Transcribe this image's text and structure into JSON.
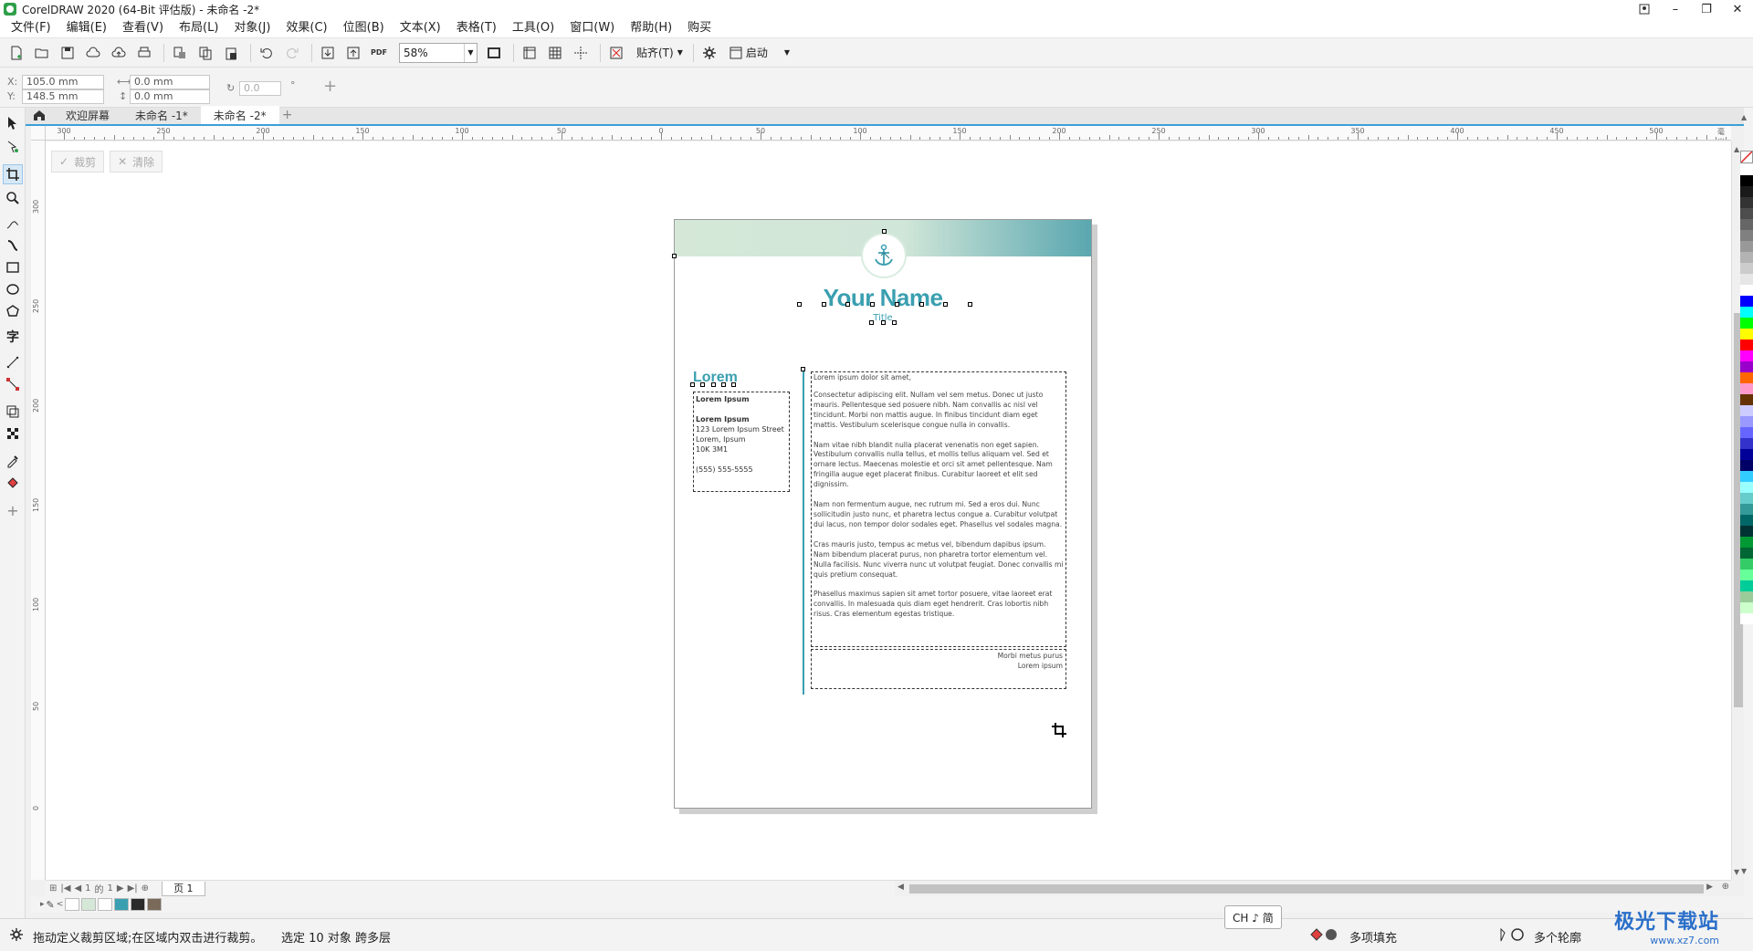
{
  "window": {
    "title": "CorelDRAW 2020 (64-Bit 评估版) - 未命名 -2*"
  },
  "menu": [
    "文件(F)",
    "编辑(E)",
    "查看(V)",
    "布局(L)",
    "对象(J)",
    "效果(C)",
    "位图(B)",
    "文本(X)",
    "表格(T)",
    "工具(O)",
    "窗口(W)",
    "帮助(H)",
    "购买"
  ],
  "toolbar": {
    "zoom_value": "58%",
    "snap_label": "贴齐(T)",
    "launch_label": "启动",
    "pdf_label": "PDF"
  },
  "propbar": {
    "x_label": "X:",
    "y_label": "Y:",
    "x_value": "105.0 mm",
    "y_value": "148.5 mm",
    "w_value": "0.0 mm",
    "h_value": "0.0 mm",
    "rotate_value": "0.0",
    "degree": "°"
  },
  "tabs": {
    "welcome": "欢迎屏幕",
    "doc1": "未命名 -1*",
    "doc2": "未命名 -2*"
  },
  "ruler_h_labels": [
    "300",
    "250",
    "200",
    "150",
    "100",
    "50",
    "0",
    "50",
    "100",
    "150",
    "200",
    "250",
    "300",
    "350",
    "400",
    "450",
    "500"
  ],
  "ruler_h_unit": "毫米",
  "ruler_v_labels": [
    "300",
    "250",
    "200",
    "150",
    "100",
    "50",
    "0"
  ],
  "crop": {
    "crop_label": "裁剪",
    "clear_label": "清除"
  },
  "page": {
    "name": "Your Name",
    "title": "Title",
    "left_heading": "Lorem",
    "left_lines": [
      "Lorem Ipsum",
      "",
      "Lorem Ipsum",
      "123 Lorem Ipsum Street",
      "Lorem, Ipsum",
      "10K 3M1",
      "",
      "(555) 555-5555"
    ],
    "right_paragraphs": [
      "Lorem ipsum dolor sit amet,",
      "Consectetur adipiscing elit. Nullam vel sem metus. Donec ut justo mauris. Pellentesque sed posuere nibh. Nam convallis ac nisl vel tincidunt. Morbi non mattis augue. In finibus tincidunt diam eget mattis. Vestibulum scelerisque congue nulla in convallis.",
      "Nam vitae nibh blandit nulla placerat venenatis non eget sapien. Vestibulum convallis nulla tellus, et mollis tellus aliquam vel. Sed et ornare lectus. Maecenas molestie et orci sit amet pellentesque. Nam fringilla augue eget placerat finibus. Curabitur laoreet et elit sed dignissim.",
      "Nam non fermentum augue, nec rutrum mi. Sed a eros dui. Nunc sollicitudin justo nunc, et pharetra lectus congue a. Curabitur volutpat dui lacus, non tempor dolor sodales eget. Phasellus vel sodales magna.",
      "Cras mauris justo, tempus ac metus vel, bibendum dapibus ipsum. Nam bibendum placerat purus, non pharetra tortor elementum vel. Nulla facilisis. Nunc viverra nunc ut volutpat feugiat. Donec convallis mi quis pretium consequat.",
      "Phasellus maximus sapien sit amet tortor posuere, vitae laoreet erat convallis. In malesuada quis diam eget hendrerit. Cras lobortis nibh risus. Cras elementum egestas tristique."
    ],
    "footer_lines": [
      "Morbi metus purus",
      "Lorem ipsum"
    ]
  },
  "page_nav": {
    "page_label": "页 1",
    "current": "1",
    "of": "的",
    "total": "1"
  },
  "status": {
    "hint": "拖动定义裁剪区域;在区域内双击进行裁剪。",
    "selection": "选定 10 对象 跨多层",
    "fill_label": "多项填充",
    "outline_label": "多个轮廓",
    "ime": "CH ♪ 简"
  },
  "watermark": {
    "main": "极光下载站",
    "sub": "www.xz7.com"
  },
  "colors": {
    "accent": "#3a9fb0",
    "tab_underline": "#3aa0d8"
  },
  "palette_colors": [
    "#ffffff",
    "#000000",
    "#1a1a1a",
    "#333333",
    "#4d4d4d",
    "#666666",
    "#808080",
    "#999999",
    "#b3b3b3",
    "#cccccc",
    "#e6e6e6",
    "#ffffff",
    "#0000ff",
    "#00ffff",
    "#00ff00",
    "#ffff00",
    "#ff0000",
    "#ff00ff",
    "#9900cc",
    "#ff6600",
    "#ff99cc",
    "#663300",
    "#ccccff",
    "#9999ff",
    "#6666ff",
    "#3333cc",
    "#000099",
    "#000066",
    "#33ccff",
    "#99ffff",
    "#66cccc",
    "#339999",
    "#006666",
    "#003333",
    "#009933",
    "#006633",
    "#33cc66",
    "#66ff99",
    "#00cc99",
    "#99cc99",
    "#ccffcc",
    "#ffffff"
  ],
  "doc_palette_colors": [
    "#ffffff",
    "#d5e8d8",
    "#ffffff",
    "#3a9fb0",
    "#2a2a2a",
    "#7a6a5a"
  ]
}
